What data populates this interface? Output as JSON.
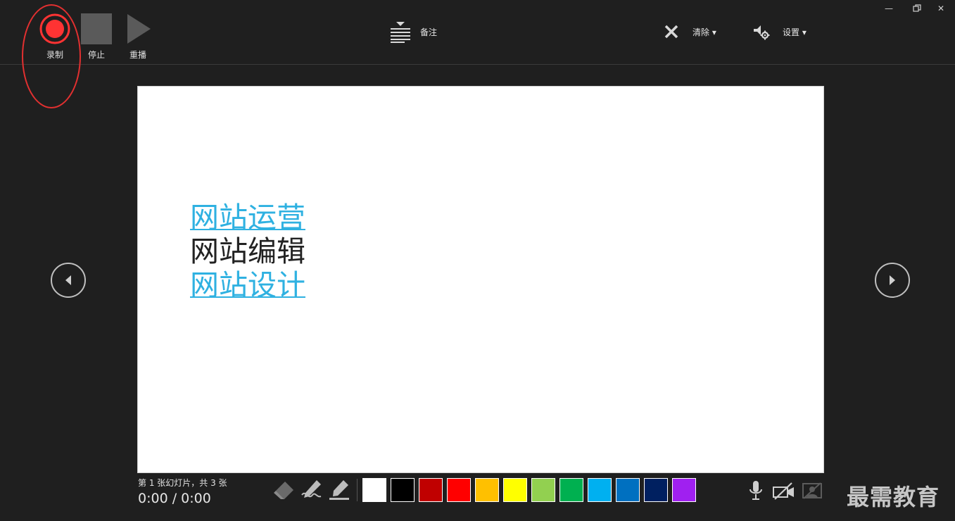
{
  "window": {
    "minimize_symbol": "—",
    "close_symbol": "✕"
  },
  "toolbar": {
    "record_label": "录制",
    "stop_label": "停止",
    "replay_label": "重播",
    "notes_label": "备注",
    "clear_label": "清除 ▾",
    "settings_label": "设置 ▾"
  },
  "slide": {
    "lines": [
      "网站运营",
      "网站编辑",
      "网站设计"
    ]
  },
  "status": {
    "slide_count": "第 1 张幻灯片，共 3 张",
    "time": "0:00  /  0:00"
  },
  "colors": {
    "record_red": "#ff3333",
    "link_blue": "#2fb1e1",
    "swatches": [
      "#ffffff",
      "#000000",
      "#c00000",
      "#ff0000",
      "#ffc000",
      "#ffff00",
      "#92d050",
      "#00b050",
      "#00b0f0",
      "#0070c0",
      "#002060",
      "#a020f0"
    ]
  },
  "icons": {
    "record": "record-icon",
    "stop": "stop-icon",
    "replay": "play-icon",
    "notes": "notes-icon",
    "clear": "close-x-icon",
    "settings": "speaker-gear-icon",
    "prev": "chevron-left-icon",
    "next": "chevron-right-icon",
    "eraser": "eraser-icon",
    "pen": "pen-icon",
    "highlighter": "highlighter-icon",
    "mic": "microphone-icon",
    "camera": "camera-off-icon",
    "preview": "camera-preview-off-icon"
  },
  "watermark": "最需教育"
}
